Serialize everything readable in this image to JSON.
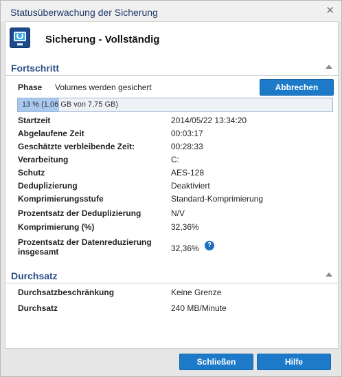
{
  "window": {
    "title": "Statusüberwachung der Sicherung",
    "close_glyph": "✕"
  },
  "job": {
    "title": "Sicherung - Vollständig",
    "icon": "backup-monitor-icon"
  },
  "progress_section": {
    "heading": "Fortschritt",
    "phase_label": "Phase",
    "phase_value": "Volumes werden gesichert",
    "cancel_label": "Abbrechen",
    "progress_text": "13 % (1,06 GB von 7,75 GB)",
    "progress_fraction": 0.13
  },
  "details": [
    {
      "label": "Startzeit",
      "value": "2014/05/22 13:34:20"
    },
    {
      "label": "Abgelaufene Zeit",
      "value": "00:03:17"
    },
    {
      "label": "Geschätzte verbleibende Zeit:",
      "value": "00:28:33"
    },
    {
      "label": "Verarbeitung",
      "value": "C:"
    },
    {
      "label": "Schutz",
      "value": "AES-128"
    },
    {
      "label": "Deduplizierung",
      "value": "Deaktiviert"
    },
    {
      "label": "Komprimierungsstufe",
      "value": "Standard-Komprimierung"
    },
    {
      "label": "Prozentsatz der Deduplizierung",
      "value": "N/V"
    },
    {
      "label": "Komprimierung (%)",
      "value": "32,36%"
    },
    {
      "label_line1": "Prozentsatz der Datenreduzierung",
      "label_line2": "insgesamt",
      "value": "32,36%"
    }
  ],
  "throughput_section": {
    "heading": "Durchsatz",
    "rows": [
      {
        "label": "Durchsatzbeschränkung",
        "value": "Keine Grenze"
      },
      {
        "label": "Durchsatz",
        "value": "240 MB/Minute"
      }
    ]
  },
  "footer": {
    "close_label": "Schließen",
    "help_label": "Hilfe"
  },
  "colors": {
    "accent": "#1d7ac9",
    "heading": "#2a4f86",
    "progress_fill": "#a9c9ef"
  }
}
